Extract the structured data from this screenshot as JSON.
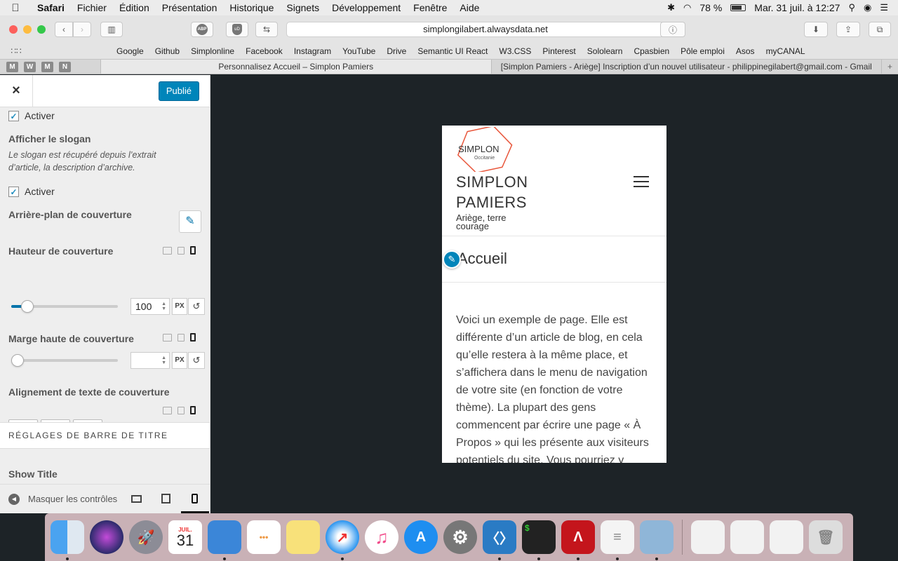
{
  "menubar": {
    "app": "Safari",
    "items": [
      "Fichier",
      "Édition",
      "Présentation",
      "Historique",
      "Signets",
      "Développement",
      "Fenêtre",
      "Aide"
    ],
    "battery": "78 %",
    "battery_level": 0.78,
    "datetime": "Mar. 31 juil. à  12:27"
  },
  "browser": {
    "url": "simplongilabert.alwaysdata.net",
    "bookmarks": [
      "Google",
      "Github",
      "Simplonline",
      "Facebook",
      "Instagram",
      "YouTube",
      "Drive",
      "Semantic UI React",
      "W3.CSS",
      "Pinterest",
      "Sololearn",
      "Cpasbien",
      "Pôle emploi",
      "Asos",
      "myCANAL"
    ],
    "pinned_tabs": [
      "M",
      "W",
      "M",
      "N"
    ],
    "tabs": [
      {
        "label": "Personnalisez Accueil – Simplon Pamiers",
        "active": true
      },
      {
        "label": "[Simplon Pamiers - Ariège] Inscription d’un nouvel utilisateur - philippinegilabert@gmail.com - Gmail",
        "active": false
      }
    ]
  },
  "sidebar": {
    "close": "×",
    "publish": "Publié",
    "activate1": "Activer",
    "slogan_label": "Afficher le slogan",
    "slogan_desc": "Le slogan est récupéré depuis l’extrait d’article, la description d’archive.",
    "activate2": "Activer",
    "cover_bg_label": "Arrière-plan de couverture",
    "cover_height_label": "Hauteur de couverture",
    "cover_height_value": "100",
    "cover_height_level": 0.15,
    "unit": "PX",
    "cover_margin_label": "Marge haute de couverture",
    "cover_margin_value": "",
    "cover_margin_level": 0,
    "text_align_label": "Alignement de texte de couverture",
    "section_title": "RÉGLAGES DE BARRE DE TITRE",
    "show_title_label": "Show Title",
    "hide_controls": "Masquer les contrôles"
  },
  "preview": {
    "logo_text": "SIMPLON",
    "logo_sub": "Occitanie",
    "site_title_line1": "SIMPLON",
    "site_title_line2": "PAMIERS",
    "tagline": "Ariège, terre courage",
    "page_title": "Accueil",
    "body": "Voici un exemple de page. Elle est différente d’un article de blog, en cela qu’elle restera à la même place, et s’affichera dans le menu de navigation de votre site (en fonction de votre thème). La plupart des gens commencent par écrire une page « À Propos » qui les présente aux visiteurs potentiels du site. Vous pourriez y"
  },
  "dock": {
    "calendar_month": "JUIL.",
    "calendar_day": "31",
    "icons": [
      "finder-icon",
      "siri-icon",
      "launchpad-icon",
      "calendar-icon",
      "keynote-icon",
      "reminders-icon",
      "notes-icon",
      "safari-icon",
      "itunes-icon",
      "app-store-icon",
      "system-preferences-icon",
      "vscode-icon",
      "terminal-icon",
      "acrobat-icon",
      "textedit-icon",
      "preview-icon"
    ]
  },
  "colors": {
    "publish": "#0085ba",
    "preview_bg": "#1d2327",
    "logo": "#e8553a"
  }
}
